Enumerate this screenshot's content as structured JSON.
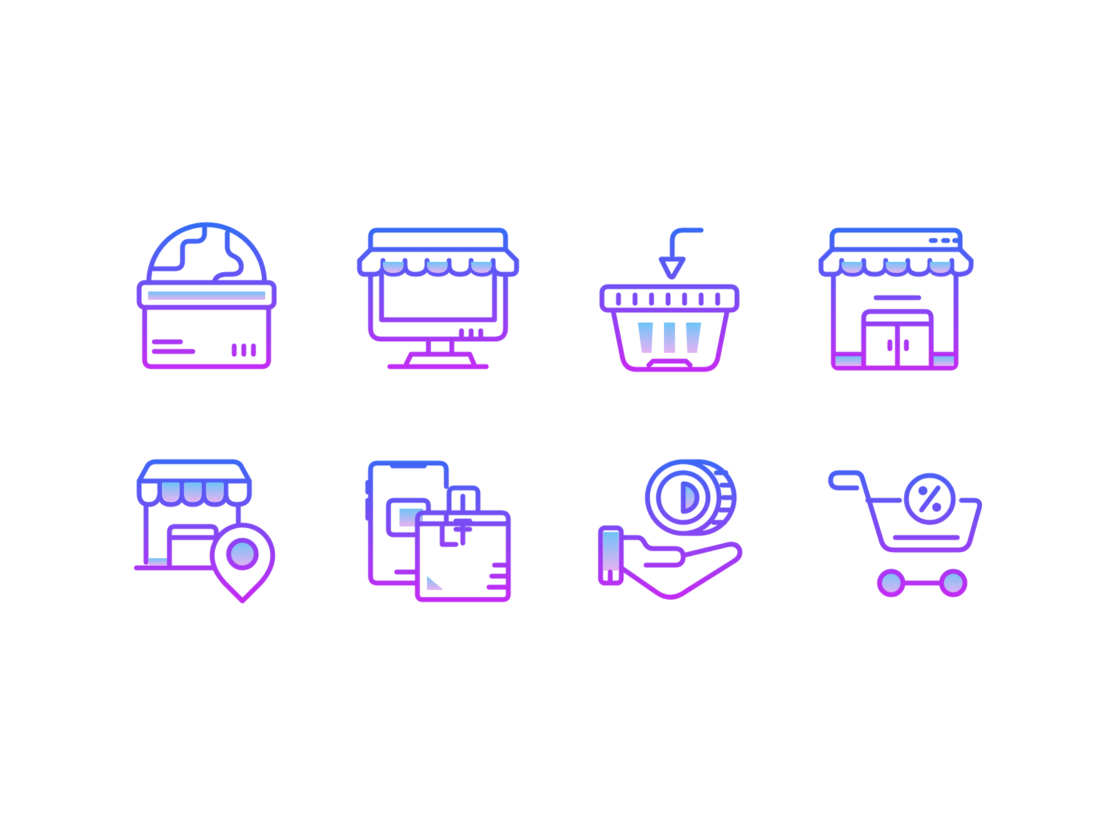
{
  "colors": {
    "background": "#ffffff",
    "gradient_top": "#2f6cf6",
    "gradient_bottom": "#c02cf3",
    "fill_top": "#6fc3f7",
    "fill_bottom": "#e6b2f2"
  },
  "icons": [
    "globe-shop-icon",
    "online-store-monitor-icon",
    "add-to-basket-icon",
    "storefront-icon",
    "store-location-icon",
    "mobile-shopping-bags-icon",
    "coin-payment-hand-icon",
    "discount-cart-icon"
  ]
}
